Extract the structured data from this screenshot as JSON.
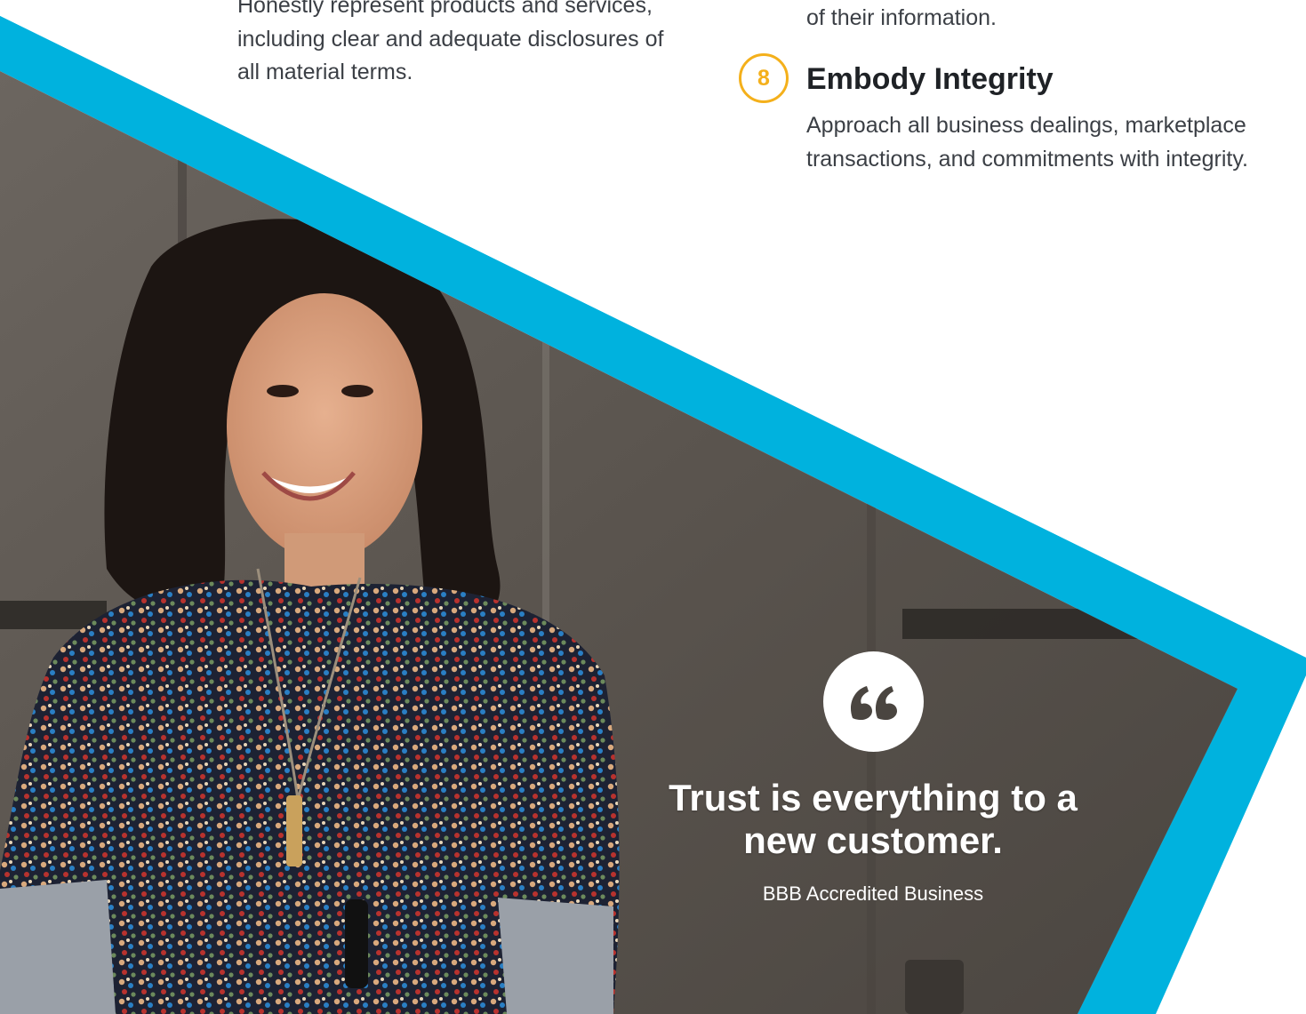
{
  "theme": {
    "accent_blue": "#00b2de",
    "badge_gold": "#f4b01b",
    "heading_dark": "#1f2226",
    "body_gray": "#3b3f45"
  },
  "left_column": {
    "paragraph_lines": [
      "Honestly represent products and services,",
      "including clear and adequate disclosures of",
      "all material terms."
    ]
  },
  "right_column": {
    "previous_paragraph_tail": "of their information.",
    "principle": {
      "number": "8",
      "title": "Embody Integrity",
      "description_lines": [
        "Approach all business dealings, marketplace",
        "transactions, and commitments with integrity."
      ]
    }
  },
  "quote": {
    "icon": "quote-mark-icon",
    "text_lines": [
      "Trust is everything to a",
      "new customer."
    ],
    "attribution": "BBB Accredited Business"
  }
}
